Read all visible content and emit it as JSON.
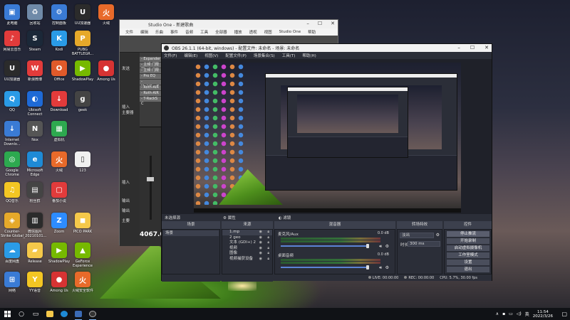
{
  "desktop": {
    "icons": [
      {
        "label": "此电脑",
        "color": "#3a7bd5",
        "glyph": "▣"
      },
      {
        "label": "网易云音乐",
        "color": "#e23b3b",
        "glyph": "♪"
      },
      {
        "label": "UU加速器",
        "color": "#2b2b2b",
        "glyph": "U"
      },
      {
        "label": "Counter-Strike Global Off...",
        "color": "#e6a92a",
        "glyph": "◈"
      },
      {
        "label": "QQ",
        "color": "#2a9be6",
        "glyph": "Q"
      },
      {
        "label": "QQ音乐",
        "color": "#f3c623",
        "glyph": "♫"
      },
      {
        "label": "Google Chrome",
        "color": "#2da94f",
        "glyph": "◎"
      },
      {
        "label": "Internet Downlo...",
        "color": "#3a7bd5",
        "glyph": "↓"
      },
      {
        "label": "百度网盘",
        "color": "#2a9be6",
        "glyph": "☁"
      },
      {
        "label": "网络",
        "color": "#3a7bd5",
        "glyph": "⊞"
      },
      {
        "label": "回收站",
        "color": "#6f8aa8",
        "glyph": "♻"
      },
      {
        "label": "Steam",
        "color": "#1b2838",
        "glyph": "S"
      },
      {
        "label": "新浪微博",
        "color": "#e23b3b",
        "glyph": "W"
      },
      {
        "label": "粉丝群",
        "color": "#444",
        "glyph": "▤"
      },
      {
        "label": "微信图片_20210101...",
        "color": "#2b2b2b",
        "glyph": "▥"
      },
      {
        "label": "YY语音",
        "color": "#f3c623",
        "glyph": "Y"
      },
      {
        "label": "Microsoft Edge",
        "color": "#1e8ad6",
        "glyph": "e"
      },
      {
        "label": "Ubisoft Connect",
        "color": "#1e6ad6",
        "glyph": "◐"
      },
      {
        "label": "控制面板",
        "color": "#3a7bd5",
        "glyph": "⚙"
      },
      {
        "label": "Among Us",
        "color": "#d63333",
        "glyph": "●"
      },
      {
        "label": "Nox",
        "color": "#555",
        "glyph": "N"
      },
      {
        "label": "Kodi",
        "color": "#2a9be6",
        "glyph": "K"
      },
      {
        "label": "Office",
        "color": "#e05a2a",
        "glyph": "O"
      },
      {
        "label": "ShadowPlay",
        "color": "#76b900",
        "glyph": "▶"
      },
      {
        "label": "Zoom",
        "color": "#2d8cff",
        "glyph": "Z"
      },
      {
        "label": "Download",
        "color": "#e23b3b",
        "glyph": "↓"
      },
      {
        "label": "虚拟机",
        "color": "#2da94f",
        "glyph": "▦"
      },
      {
        "label": "Release",
        "color": "#f5c84a",
        "glyph": "▰"
      },
      {
        "label": "Among Us",
        "color": "#d63333",
        "glyph": "●"
      },
      {
        "label": "PUBG BATTLEGR...",
        "color": "#e6a92a",
        "glyph": "P"
      },
      {
        "label": "火绒",
        "color": "#e86a2a",
        "glyph": "火"
      },
      {
        "label": "geek",
        "color": "#444",
        "glyph": "g"
      },
      {
        "label": "番茄小说",
        "color": "#e23b3b",
        "glyph": "▢"
      },
      {
        "label": "123",
        "color": "#f0f0f0",
        "glyph": "▯"
      },
      {
        "label": "PICO PARK",
        "color": "#f5c84a",
        "glyph": "◼"
      },
      {
        "label": "GeForce Experience",
        "color": "#76b900",
        "glyph": "▲"
      },
      {
        "label": "火绒安全软件",
        "color": "#e86a2a",
        "glyph": "火"
      }
    ]
  },
  "studio_one": {
    "title": "Studio One - 新建歌曲",
    "menu": [
      "文件",
      "编辑",
      "乐曲",
      "事件",
      "音频",
      "工具",
      "全部器",
      "播放",
      "透视",
      "视图",
      "Studio One",
      "帮助"
    ],
    "tracks": [
      "- Expander",
      "- 主频 门限器",
      "- 主频 门限",
      "- Pro EQ",
      "- MultiBanD",
      "- Roth-AIR v",
      "- Roth-AIR",
      "- T-RackS C"
    ],
    "sidebar_labels": [
      "发送",
      "插入",
      "主要器",
      "插入",
      "输出",
      "输出",
      "主要"
    ],
    "counter": "4067.0"
  },
  "obs": {
    "title": "OBS 26.1.1 (64-bit, windows) - 配置文件: 未命名 - 场景: 未命名",
    "menu": [
      "文件(F)",
      "编辑(E)",
      "视图(V)",
      "配置文件(P)",
      "场景集合(S)",
      "工具(T)",
      "帮助(H)"
    ],
    "status": "未选择源",
    "props_label": "属性",
    "filters_label": "滤镜",
    "docks": {
      "scenes": {
        "header": "场景",
        "items": [
          "场景"
        ]
      },
      "sources": {
        "header": "来源",
        "items": [
          "1.mp",
          "2 geo",
          "文本 (GDI+) 2",
          "视频",
          "图像",
          "视频捕获设备"
        ]
      },
      "mixer": {
        "header": "混音器",
        "channels": [
          {
            "name": "麦克风/Aux",
            "db": "0.0 dB"
          },
          {
            "name": "桌面音频",
            "db": "0.0 dB"
          }
        ]
      },
      "transitions": {
        "header": "转场特效",
        "type": "淡出",
        "duration_label": "时长",
        "duration": "300 ms"
      },
      "controls": {
        "header": "控件",
        "buttons": [
          "停止推流",
          "开始录制",
          "启动虚拟摄像机",
          "工作室模式",
          "设置",
          "退出"
        ]
      }
    },
    "statusbar": {
      "live": "LIVE: 00:00:00",
      "rec": "REC: 00:00:00",
      "cpu": "CPU: 5.7%, 30.00 fps"
    }
  },
  "taskbar": {
    "time": "11:54",
    "date": "2022/3/26",
    "lang": "英"
  }
}
